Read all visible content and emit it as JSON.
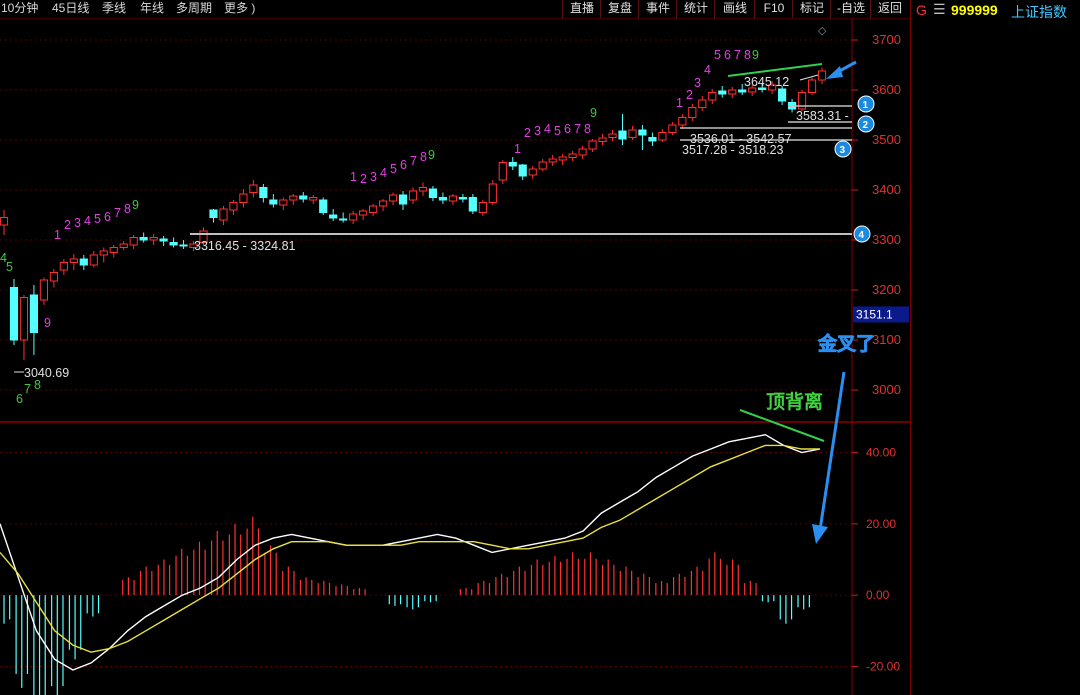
{
  "toolbar": {
    "period_tabs": [
      "10分钟",
      "45日线",
      "季线",
      "年线",
      "多周期",
      "更多 )"
    ],
    "buttons": [
      "直播",
      "复盘",
      "事件",
      "统计",
      "画线",
      "F10",
      "标记",
      "-自选",
      "返回"
    ]
  },
  "security": {
    "marker": "G",
    "menu_icon": "hamburger-icon",
    "code": "999999",
    "name": "上证指数",
    "code_color": "#ffff00",
    "name_color": "#40c8ff"
  },
  "price_axis": {
    "ticks": [
      3700,
      3600,
      3500,
      3400,
      3300,
      3200,
      3100,
      3000
    ],
    "current_price_label": "3151.1"
  },
  "macd_axis": {
    "ticks": [
      "40.00",
      "20.00",
      "0.00",
      "-20.00"
    ]
  },
  "annotations": {
    "golden_cross_label": "金叉了",
    "top_divergence_label": "顶背离",
    "td_sequence_counts": [
      {
        "text": "4",
        "color": "#3ec83e"
      },
      {
        "text": "5",
        "color": "#3ec83e"
      },
      {
        "text": "6",
        "color": "#3ec83e"
      },
      {
        "text": "7",
        "color": "#3ec83e"
      },
      {
        "text": "8",
        "color": "#3ec83e"
      },
      {
        "text": "9",
        "color": "#e040e0"
      },
      {
        "text": "1",
        "color": "#e040e0"
      },
      {
        "text": "2",
        "color": "#e040e0"
      },
      {
        "text": "3",
        "color": "#e040e0"
      },
      {
        "text": "4",
        "color": "#e040e0"
      },
      {
        "text": "5",
        "color": "#e040e0"
      },
      {
        "text": "6",
        "color": "#e040e0"
      },
      {
        "text": "7",
        "color": "#e040e0"
      },
      {
        "text": "8",
        "color": "#e040e0"
      },
      {
        "text": "9",
        "color": "#3ec83e"
      },
      {
        "text": "1",
        "color": "#e040e0"
      },
      {
        "text": "2",
        "color": "#e040e0"
      },
      {
        "text": "3",
        "color": "#e040e0"
      },
      {
        "text": "4",
        "color": "#e040e0"
      },
      {
        "text": "5",
        "color": "#e040e0"
      },
      {
        "text": "6",
        "color": "#e040e0"
      },
      {
        "text": "7",
        "color": "#e040e0"
      },
      {
        "text": "8",
        "color": "#e040e0"
      },
      {
        "text": "9",
        "color": "#3ec83e"
      },
      {
        "text": "1",
        "color": "#e040e0"
      },
      {
        "text": "2",
        "color": "#e040e0"
      },
      {
        "text": "3",
        "color": "#e040e0"
      },
      {
        "text": "4",
        "color": "#e040e0"
      },
      {
        "text": "5",
        "color": "#e040e0"
      },
      {
        "text": "6",
        "color": "#e040e0"
      },
      {
        "text": "7",
        "color": "#e040e0"
      },
      {
        "text": "8",
        "color": "#e040e0"
      },
      {
        "text": "9",
        "color": "#3ec83e"
      },
      {
        "text": "1",
        "color": "#e040e0"
      },
      {
        "text": "2",
        "color": "#e040e0"
      },
      {
        "text": "3",
        "color": "#e040e0"
      },
      {
        "text": "4",
        "color": "#e040e0"
      },
      {
        "text": "5",
        "color": "#e040e0"
      },
      {
        "text": "6",
        "color": "#e040e0"
      },
      {
        "text": "7",
        "color": "#e040e0"
      },
      {
        "text": "8",
        "color": "#e040e0"
      },
      {
        "text": "9",
        "color": "#3ec83e"
      }
    ],
    "price_labels": [
      "3040.69",
      "3316.45 - 3324.81",
      "3517.28 - 3518.23",
      "3536.01 - 3542.57",
      "3583.31 -",
      "3645.12"
    ],
    "level_badges": [
      "1",
      "2",
      "3",
      "4"
    ]
  },
  "chart_data": [
    {
      "type": "candlestick",
      "ylim": [
        2940,
        3740
      ],
      "y_ticks": [
        3000,
        3100,
        3200,
        3300,
        3400,
        3500,
        3600,
        3700
      ],
      "current_price": 3151.1,
      "candles": [
        {
          "o": 3330,
          "h": 3360,
          "l": 3310,
          "c": 3345
        },
        {
          "o": 3205,
          "h": 3222,
          "l": 3090,
          "c": 3100
        },
        {
          "o": 3100,
          "h": 3190,
          "l": 3060,
          "c": 3185
        },
        {
          "o": 3190,
          "h": 3210,
          "l": 3070,
          "c": 3115
        },
        {
          "o": 3180,
          "h": 3225,
          "l": 3170,
          "c": 3220
        },
        {
          "o": 3218,
          "h": 3242,
          "l": 3205,
          "c": 3235
        },
        {
          "o": 3240,
          "h": 3262,
          "l": 3230,
          "c": 3255
        },
        {
          "o": 3255,
          "h": 3272,
          "l": 3240,
          "c": 3262
        },
        {
          "o": 3262,
          "h": 3270,
          "l": 3240,
          "c": 3250
        },
        {
          "o": 3250,
          "h": 3278,
          "l": 3245,
          "c": 3270
        },
        {
          "o": 3270,
          "h": 3285,
          "l": 3255,
          "c": 3278
        },
        {
          "o": 3275,
          "h": 3290,
          "l": 3265,
          "c": 3285
        },
        {
          "o": 3285,
          "h": 3298,
          "l": 3280,
          "c": 3292
        },
        {
          "o": 3290,
          "h": 3310,
          "l": 3282,
          "c": 3305
        },
        {
          "o": 3305,
          "h": 3315,
          "l": 3295,
          "c": 3300
        },
        {
          "o": 3300,
          "h": 3312,
          "l": 3290,
          "c": 3305
        },
        {
          "o": 3302,
          "h": 3308,
          "l": 3288,
          "c": 3298
        },
        {
          "o": 3295,
          "h": 3305,
          "l": 3285,
          "c": 3290
        },
        {
          "o": 3290,
          "h": 3300,
          "l": 3282,
          "c": 3288
        },
        {
          "o": 3285,
          "h": 3298,
          "l": 3278,
          "c": 3292
        },
        {
          "o": 3295,
          "h": 3325,
          "l": 3290,
          "c": 3318
        },
        {
          "o": 3360,
          "h": 3362,
          "l": 3335,
          "c": 3345
        },
        {
          "o": 3340,
          "h": 3368,
          "l": 3330,
          "c": 3362
        },
        {
          "o": 3360,
          "h": 3380,
          "l": 3350,
          "c": 3375
        },
        {
          "o": 3375,
          "h": 3402,
          "l": 3365,
          "c": 3392
        },
        {
          "o": 3395,
          "h": 3420,
          "l": 3385,
          "c": 3410
        },
        {
          "o": 3405,
          "h": 3412,
          "l": 3375,
          "c": 3385
        },
        {
          "o": 3380,
          "h": 3392,
          "l": 3365,
          "c": 3372
        },
        {
          "o": 3370,
          "h": 3385,
          "l": 3360,
          "c": 3380
        },
        {
          "o": 3380,
          "h": 3392,
          "l": 3370,
          "c": 3388
        },
        {
          "o": 3388,
          "h": 3396,
          "l": 3375,
          "c": 3382
        },
        {
          "o": 3380,
          "h": 3390,
          "l": 3372,
          "c": 3385
        },
        {
          "o": 3380,
          "h": 3385,
          "l": 3350,
          "c": 3355
        },
        {
          "o": 3350,
          "h": 3362,
          "l": 3338,
          "c": 3344
        },
        {
          "o": 3342,
          "h": 3355,
          "l": 3335,
          "c": 3340
        },
        {
          "o": 3340,
          "h": 3358,
          "l": 3332,
          "c": 3352
        },
        {
          "o": 3350,
          "h": 3362,
          "l": 3340,
          "c": 3358
        },
        {
          "o": 3355,
          "h": 3372,
          "l": 3348,
          "c": 3368
        },
        {
          "o": 3368,
          "h": 3382,
          "l": 3358,
          "c": 3378
        },
        {
          "o": 3378,
          "h": 3395,
          "l": 3370,
          "c": 3390
        },
        {
          "o": 3390,
          "h": 3398,
          "l": 3360,
          "c": 3372
        },
        {
          "o": 3380,
          "h": 3405,
          "l": 3372,
          "c": 3398
        },
        {
          "o": 3398,
          "h": 3415,
          "l": 3388,
          "c": 3405
        },
        {
          "o": 3402,
          "h": 3408,
          "l": 3378,
          "c": 3385
        },
        {
          "o": 3385,
          "h": 3395,
          "l": 3372,
          "c": 3380
        },
        {
          "o": 3378,
          "h": 3392,
          "l": 3370,
          "c": 3388
        },
        {
          "o": 3385,
          "h": 3392,
          "l": 3375,
          "c": 3382
        },
        {
          "o": 3385,
          "h": 3392,
          "l": 3352,
          "c": 3358
        },
        {
          "o": 3355,
          "h": 3380,
          "l": 3348,
          "c": 3375
        },
        {
          "o": 3375,
          "h": 3420,
          "l": 3370,
          "c": 3412
        },
        {
          "o": 3420,
          "h": 3460,
          "l": 3412,
          "c": 3455
        },
        {
          "o": 3455,
          "h": 3466,
          "l": 3440,
          "c": 3448
        },
        {
          "o": 3450,
          "h": 3452,
          "l": 3420,
          "c": 3428
        },
        {
          "o": 3430,
          "h": 3448,
          "l": 3422,
          "c": 3442
        },
        {
          "o": 3442,
          "h": 3462,
          "l": 3438,
          "c": 3456
        },
        {
          "o": 3456,
          "h": 3470,
          "l": 3448,
          "c": 3462
        },
        {
          "o": 3460,
          "h": 3472,
          "l": 3450,
          "c": 3466
        },
        {
          "o": 3465,
          "h": 3478,
          "l": 3458,
          "c": 3472
        },
        {
          "o": 3470,
          "h": 3488,
          "l": 3462,
          "c": 3482
        },
        {
          "o": 3482,
          "h": 3502,
          "l": 3476,
          "c": 3498
        },
        {
          "o": 3497,
          "h": 3512,
          "l": 3490,
          "c": 3504
        },
        {
          "o": 3505,
          "h": 3520,
          "l": 3498,
          "c": 3512
        },
        {
          "o": 3518,
          "h": 3552,
          "l": 3490,
          "c": 3502
        },
        {
          "o": 3505,
          "h": 3528,
          "l": 3500,
          "c": 3520
        },
        {
          "o": 3520,
          "h": 3530,
          "l": 3480,
          "c": 3510
        },
        {
          "o": 3505,
          "h": 3515,
          "l": 3488,
          "c": 3498
        },
        {
          "o": 3500,
          "h": 3522,
          "l": 3496,
          "c": 3515
        },
        {
          "o": 3515,
          "h": 3536,
          "l": 3510,
          "c": 3530
        },
        {
          "o": 3530,
          "h": 3552,
          "l": 3522,
          "c": 3545
        },
        {
          "o": 3545,
          "h": 3572,
          "l": 3538,
          "c": 3565
        },
        {
          "o": 3565,
          "h": 3588,
          "l": 3558,
          "c": 3580
        },
        {
          "o": 3580,
          "h": 3602,
          "l": 3572,
          "c": 3595
        },
        {
          "o": 3598,
          "h": 3608,
          "l": 3585,
          "c": 3592
        },
        {
          "o": 3592,
          "h": 3606,
          "l": 3584,
          "c": 3600
        },
        {
          "o": 3600,
          "h": 3612,
          "l": 3590,
          "c": 3596
        },
        {
          "o": 3596,
          "h": 3610,
          "l": 3588,
          "c": 3604
        },
        {
          "o": 3604,
          "h": 3612,
          "l": 3595,
          "c": 3601
        },
        {
          "o": 3600,
          "h": 3618,
          "l": 3592,
          "c": 3610
        },
        {
          "o": 3602,
          "h": 3608,
          "l": 3570,
          "c": 3578
        },
        {
          "o": 3575,
          "h": 3582,
          "l": 3555,
          "c": 3562
        },
        {
          "o": 3562,
          "h": 3600,
          "l": 3558,
          "c": 3595
        },
        {
          "o": 3595,
          "h": 3625,
          "l": 3590,
          "c": 3620
        },
        {
          "o": 3620,
          "h": 3645,
          "l": 3612,
          "c": 3638
        }
      ]
    },
    {
      "type": "macd",
      "ylim": [
        -28,
        48
      ],
      "y_ticks": [
        -20,
        0,
        20,
        40
      ],
      "series": [
        {
          "name": "DIF",
          "color": "#ffffff",
          "values": [
            20,
            5,
            -10,
            -18,
            -21,
            -19,
            -15,
            -10,
            -6,
            -3,
            0,
            2,
            5,
            10,
            14,
            16,
            17,
            16,
            15,
            14,
            14,
            14,
            15,
            16,
            17,
            16,
            14,
            12,
            13,
            14,
            15,
            16,
            18,
            23,
            26,
            29,
            33,
            36,
            39,
            41,
            43,
            44,
            45,
            42,
            40,
            41
          ]
        },
        {
          "name": "DEA",
          "color": "#e8e040",
          "values": [
            12,
            6,
            -2,
            -10,
            -14,
            -16,
            -15,
            -13,
            -10,
            -7,
            -4,
            -1,
            2,
            6,
            10,
            13,
            15,
            15,
            15,
            14,
            14,
            14,
            14,
            15,
            15,
            15,
            15,
            14,
            13,
            13,
            14,
            15,
            16,
            19,
            21,
            24,
            27,
            30,
            33,
            36,
            38,
            40,
            42,
            42,
            41,
            41
          ]
        }
      ],
      "histogram": [
        -8,
        -26,
        -35,
        -30,
        -18,
        -6,
        0,
        5,
        8,
        10,
        13,
        15,
        18,
        20,
        22,
        14,
        8,
        5,
        4,
        3,
        2,
        0,
        -3,
        -4,
        -2,
        0,
        2,
        4,
        6,
        8,
        10,
        11,
        12,
        12,
        10,
        8,
        6,
        4,
        6,
        8,
        12,
        10,
        4,
        -2,
        -8,
        -4
      ]
    }
  ]
}
